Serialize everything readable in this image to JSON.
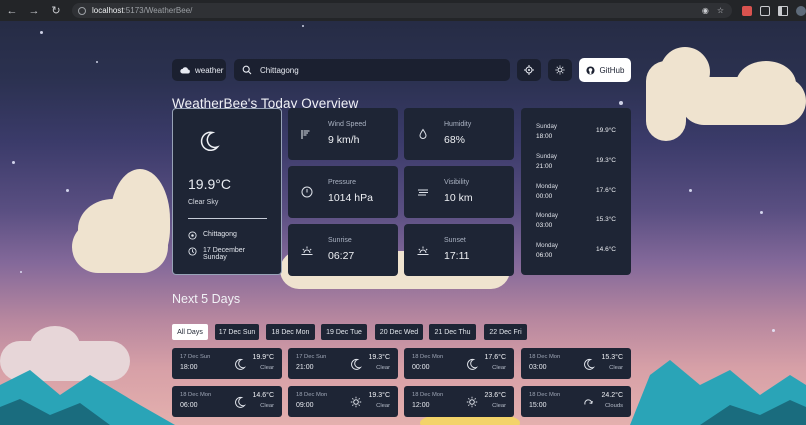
{
  "browser": {
    "url_host": "localhost",
    "url_path": ":5173/WeatherBee/"
  },
  "header": {
    "brand_label": "weather",
    "search_value": "Chittagong",
    "github_label": "GitHub"
  },
  "page_title": "WeatherBee's Today Overview",
  "current": {
    "temperature": "19.9°C",
    "condition": "Clear Sky",
    "location": "Chittagong",
    "date_line1": "17 December",
    "date_line2": "Sunday"
  },
  "stats": [
    {
      "label": "Wind Speed",
      "value": "9 km/h",
      "icon": "wind-icon"
    },
    {
      "label": "Humidity",
      "value": "68%",
      "icon": "droplet-icon"
    },
    {
      "label": "Pressure",
      "value": "1014 hPa",
      "icon": "gauge-icon"
    },
    {
      "label": "Visibility",
      "value": "10 km",
      "icon": "fog-lines-icon"
    },
    {
      "label": "Sunrise",
      "value": "06:27",
      "icon": "sunrise-icon"
    },
    {
      "label": "Sunset",
      "value": "17:11",
      "icon": "sunset-icon"
    }
  ],
  "hourly": [
    {
      "day": "Sunday",
      "time": "18:00",
      "temp": "19.9°C"
    },
    {
      "day": "Sunday",
      "time": "21:00",
      "temp": "19.3°C"
    },
    {
      "day": "Monday",
      "time": "00:00",
      "temp": "17.6°C"
    },
    {
      "day": "Monday",
      "time": "03:00",
      "temp": "15.3°C"
    },
    {
      "day": "Monday",
      "time": "06:00",
      "temp": "14.6°C"
    }
  ],
  "next_days_title": "Next 5 Days",
  "filters": [
    "All Days",
    "17 Dec Sun",
    "18 Dec Mon",
    "19 Dec Tue",
    "20 Dec Wed",
    "21 Dec Thu",
    "22 Dec Fri"
  ],
  "forecast": [
    {
      "date": "17 Dec Sun",
      "time": "18:00",
      "temp": "19.9°C",
      "cond": "Clear",
      "icon": "moon-icon"
    },
    {
      "date": "17 Dec Sun",
      "time": "21:00",
      "temp": "19.3°C",
      "cond": "Clear",
      "icon": "moon-icon"
    },
    {
      "date": "18 Dec Mon",
      "time": "00:00",
      "temp": "17.6°C",
      "cond": "Clear",
      "icon": "moon-icon"
    },
    {
      "date": "18 Dec Mon",
      "time": "03:00",
      "temp": "15.3°C",
      "cond": "Clear",
      "icon": "moon-icon"
    },
    {
      "date": "18 Dec Mon",
      "time": "06:00",
      "temp": "14.6°C",
      "cond": "Clear",
      "icon": "moon-icon"
    },
    {
      "date": "18 Dec Mon",
      "time": "09:00",
      "temp": "19.3°C",
      "cond": "Clear",
      "icon": "sun-icon"
    },
    {
      "date": "18 Dec Mon",
      "time": "12:00",
      "temp": "23.6°C",
      "cond": "Clear",
      "icon": "sun-icon"
    },
    {
      "date": "18 Dec Mon",
      "time": "15:00",
      "temp": "24.2°C",
      "cond": "Clouds",
      "icon": "cloud-icon"
    }
  ],
  "colors": {
    "card_bg": "#1e2535",
    "accent_white": "#ffffff",
    "text_primary": "#eef0f4"
  }
}
